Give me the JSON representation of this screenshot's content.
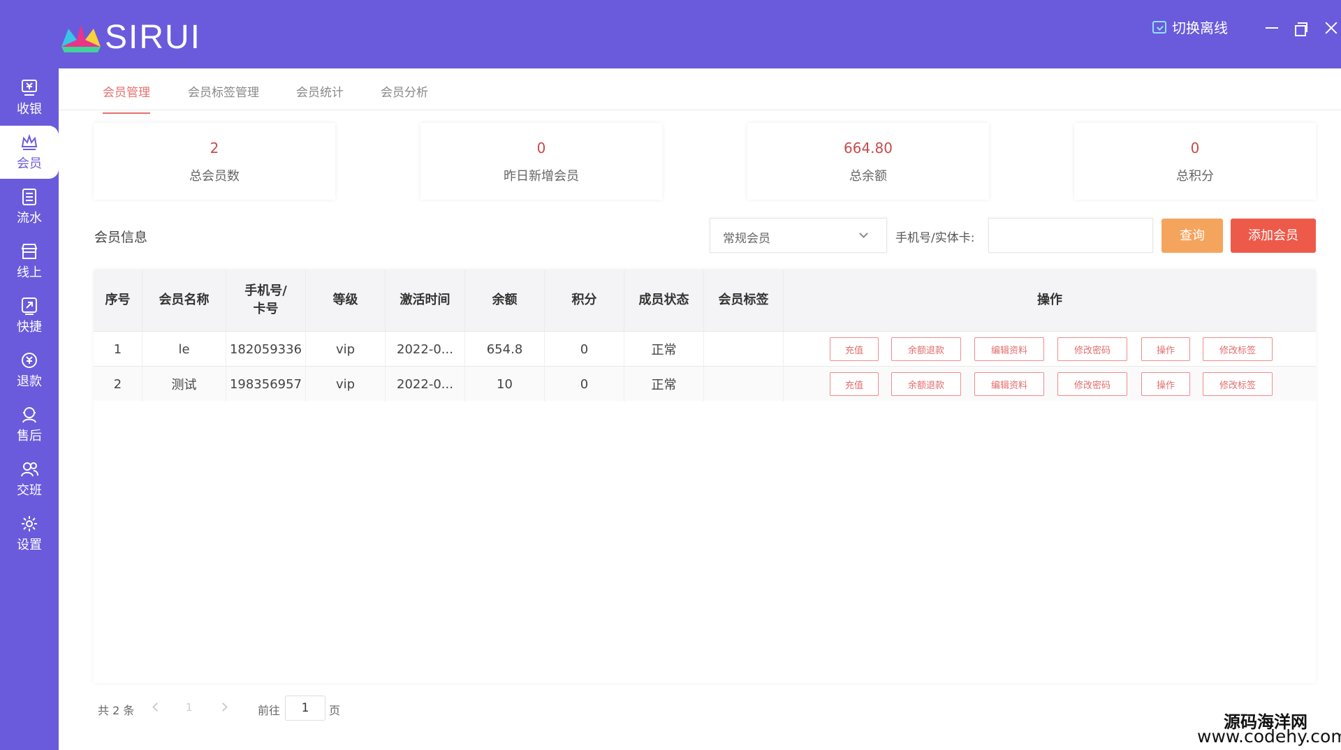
{
  "app": {
    "logo_text": "SIRUI",
    "offline_switch_label": "切换离线"
  },
  "sidebar": {
    "items": [
      {
        "label": "收银",
        "icon": "cashier-icon"
      },
      {
        "label": "会员",
        "icon": "member-crown-icon"
      },
      {
        "label": "流水",
        "icon": "ledger-icon"
      },
      {
        "label": "线上",
        "icon": "store-icon"
      },
      {
        "label": "快捷",
        "icon": "quick-icon"
      },
      {
        "label": "退款",
        "icon": "refund-icon"
      },
      {
        "label": "售后",
        "icon": "aftersale-icon"
      },
      {
        "label": "交班",
        "icon": "shift-icon"
      },
      {
        "label": "设置",
        "icon": "gear-icon"
      }
    ],
    "active_index": 1
  },
  "tabs": [
    {
      "label": "会员管理"
    },
    {
      "label": "会员标签管理"
    },
    {
      "label": "会员统计"
    },
    {
      "label": "会员分析"
    }
  ],
  "stats": [
    {
      "value": "2",
      "label": "总会员数"
    },
    {
      "value": "0",
      "label": "昨日新增会员"
    },
    {
      "value": "664.80",
      "label": "总余额"
    },
    {
      "value": "0",
      "label": "总积分"
    }
  ],
  "filter": {
    "section_title": "会员信息",
    "type_selected": "常规会员",
    "search_label": "手机号/实体卡:",
    "search_value": "",
    "query_button": "查询",
    "add_button": "添加会员"
  },
  "table": {
    "headers": [
      "序号",
      "会员名称",
      "手机号/卡号",
      "等级",
      "激活时间",
      "余额",
      "积分",
      "成员状态",
      "会员标签",
      "操作"
    ],
    "rows": [
      {
        "index": "1",
        "name": "le",
        "phone": "182059336",
        "level": "vip",
        "activated": "2022-0...",
        "balance": "654.8",
        "points": "0",
        "status": "正常",
        "tags": ""
      },
      {
        "index": "2",
        "name": "测试",
        "phone": "198356957",
        "level": "vip",
        "activated": "2022-0...",
        "balance": "10",
        "points": "0",
        "status": "正常",
        "tags": ""
      }
    ],
    "actions": [
      "充值",
      "余额退款",
      "编辑资料",
      "修改密码",
      "操作",
      "修改标签"
    ]
  },
  "pagination": {
    "total_text": "共 2 条",
    "current_page": "1",
    "goto_label": "前往",
    "goto_value": "1",
    "page_suffix": "页"
  },
  "watermark": {
    "line1": "源码海洋网",
    "line2": "www.codehy.com"
  },
  "colors": {
    "brand": "#6a5bdc",
    "accent_red": "#ee5a4a",
    "accent_orange": "#f5a45d",
    "stat_value": "#c94a4a"
  }
}
